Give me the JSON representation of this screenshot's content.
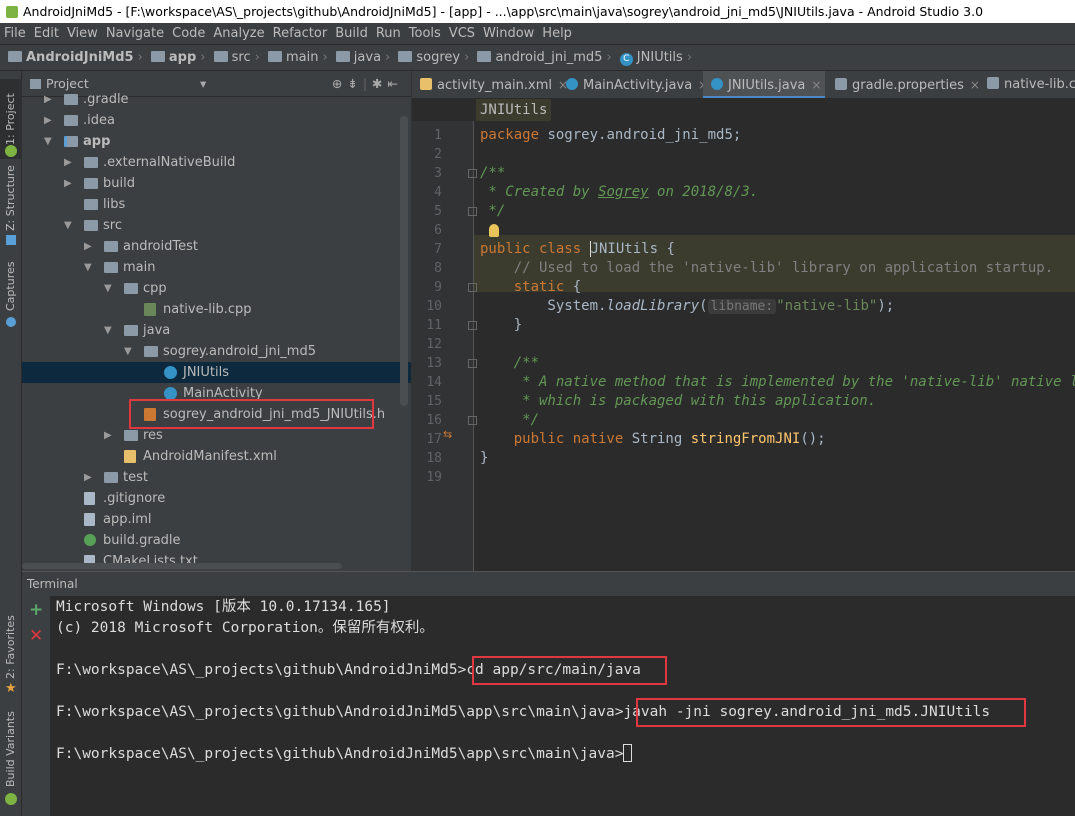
{
  "window": {
    "title": "AndroidJniMd5 - [F:\\workspace\\AS\\_projects\\github\\AndroidJniMd5] - [app] - ...\\app\\src\\main\\java\\sogrey\\android_jni_md5\\JNIUtils.java - Android Studio 3.0"
  },
  "menu": [
    "File",
    "Edit",
    "View",
    "Navigate",
    "Code",
    "Analyze",
    "Refactor",
    "Build",
    "Run",
    "Tools",
    "VCS",
    "Window",
    "Help"
  ],
  "nav": {
    "crumbs": [
      "AndroidJniMd5",
      "app",
      "src",
      "main",
      "java",
      "sogrey",
      "android_jni_md5",
      "JNIUtils"
    ]
  },
  "side_tabs": {
    "project": "1: Project",
    "structure": "Z: Structure",
    "captures": "Captures",
    "favorites": "2: Favorites",
    "build_variants": "Build Variants"
  },
  "project": {
    "header": "Project",
    "tree": [
      {
        "label": ".gradle",
        "depth": 1,
        "arrow": "▶",
        "icon": "folder"
      },
      {
        "label": ".idea",
        "depth": 1,
        "arrow": "▶",
        "icon": "folder"
      },
      {
        "label": "app",
        "depth": 1,
        "arrow": "▼",
        "icon": "mod"
      },
      {
        "label": ".externalNativeBuild",
        "depth": 2,
        "arrow": "▶",
        "icon": "folder"
      },
      {
        "label": "build",
        "depth": 2,
        "arrow": "▶",
        "icon": "folder"
      },
      {
        "label": "libs",
        "depth": 2,
        "arrow": "",
        "icon": "folder"
      },
      {
        "label": "src",
        "depth": 2,
        "arrow": "▼",
        "icon": "folder"
      },
      {
        "label": "androidTest",
        "depth": 3,
        "arrow": "▶",
        "icon": "folder"
      },
      {
        "label": "main",
        "depth": 3,
        "arrow": "▼",
        "icon": "folder"
      },
      {
        "label": "cpp",
        "depth": 4,
        "arrow": "▼",
        "icon": "folder"
      },
      {
        "label": "native-lib.cpp",
        "depth": 5,
        "arrow": "",
        "icon": "cpp"
      },
      {
        "label": "java",
        "depth": 4,
        "arrow": "▼",
        "icon": "folder"
      },
      {
        "label": "sogrey.android_jni_md5",
        "depth": 5,
        "arrow": "▼",
        "icon": "pkg"
      },
      {
        "label": "JNIUtils",
        "depth": 6,
        "arrow": "",
        "icon": "cls",
        "selected": true
      },
      {
        "label": "MainActivity",
        "depth": 6,
        "arrow": "",
        "icon": "cls"
      },
      {
        "label": "sogrey_android_jni_md5_JNIUtils.h",
        "depth": 5,
        "arrow": "",
        "icon": "h"
      },
      {
        "label": "res",
        "depth": 4,
        "arrow": "▶",
        "icon": "folder"
      },
      {
        "label": "AndroidManifest.xml",
        "depth": 4,
        "arrow": "",
        "icon": "xml"
      },
      {
        "label": "test",
        "depth": 3,
        "arrow": "▶",
        "icon": "folder"
      },
      {
        "label": ".gitignore",
        "depth": 2,
        "arrow": "",
        "icon": "file"
      },
      {
        "label": "app.iml",
        "depth": 2,
        "arrow": "",
        "icon": "file"
      },
      {
        "label": "build.gradle",
        "depth": 2,
        "arrow": "",
        "icon": "gradle"
      },
      {
        "label": "CMakeLists.txt",
        "depth": 2,
        "arrow": "",
        "icon": "file"
      }
    ]
  },
  "editor": {
    "tabs": [
      {
        "label": "activity_main.xml",
        "icon": "xml"
      },
      {
        "label": "MainActivity.java",
        "icon": "cls"
      },
      {
        "label": "JNIUtils.java",
        "icon": "cls",
        "active": true
      },
      {
        "label": "gradle.properties",
        "icon": "gr"
      },
      {
        "label": "native-lib.cpp",
        "icon": "gr"
      }
    ],
    "breadcrumb": "JNIUtils",
    "line_numbers": [
      "1",
      "2",
      "3",
      "4",
      "5",
      "6",
      "7",
      "8",
      "9",
      "10",
      "11",
      "12",
      "13",
      "14",
      "15",
      "16",
      "17",
      "18",
      "19"
    ],
    "code": {
      "l1_kw": "package",
      "l1_rest": " sogrey.android_jni_md5;",
      "l3": "/**",
      "l4a": " * Created by ",
      "l4b": "Sogrey",
      "l4c": " on 2018/8/3.",
      "l5": " */",
      "l7_kw": "public class ",
      "l7_name": "JNIUtils",
      "l7_rest": " {",
      "l8": "    // Used to load the 'native-lib' library on application startup.",
      "l9_kw": "    static",
      "l9_rest": " {",
      "l10a": "        System.",
      "l10b": "loadLibrary",
      "l10c": "(",
      "l10_hint": "libname:",
      "l10d": "\"native-lib\"",
      "l10e": ");",
      "l11": "    }",
      "l13": "    /**",
      "l14": "     * A native method that is implemented by the 'native-lib' native library,",
      "l15": "     * which is packaged with this application.",
      "l16": "     */",
      "l17_kw": "    public native ",
      "l17_type": "String ",
      "l17_fn": "stringFromJNI",
      "l17_rest": "();",
      "l18": "}"
    }
  },
  "terminal": {
    "title": "Terminal",
    "lines": [
      "Microsoft Windows [版本 10.0.17134.165]",
      "(c) 2018 Microsoft Corporation。保留所有权利。",
      "F:\\workspace\\AS\\_projects\\github\\AndroidJniMd5>",
      "cd app/src/main/java",
      "F:\\workspace\\AS\\_projects\\github\\AndroidJniMd5\\app\\src\\main\\java>",
      "javah -jni sogrey.android_jni_md5.JNIUtils",
      "F:\\workspace\\AS\\_projects\\github\\AndroidJniMd5\\app\\src\\main\\java>"
    ],
    "add_icon": "plus-icon",
    "close_icon": "close-icon"
  },
  "colors": {
    "highlight_box": "#e0383e",
    "accent": "#4a88c7",
    "selection": "#0d293e"
  }
}
